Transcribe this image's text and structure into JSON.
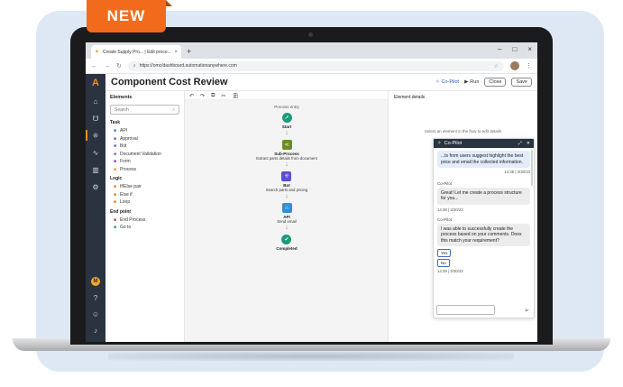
{
  "badge": "NEW",
  "browser": {
    "tab_title": "Create Supply Pro... | Edit proce...",
    "tab_close": "×",
    "new_tab": "+",
    "window_controls": [
      "–",
      "□",
      "×"
    ],
    "url": "https://omc/dashboard.automationanywhere.com"
  },
  "app": {
    "title": "Component Cost Review",
    "copilot_label": "Co-Pilot",
    "run_label": "Run",
    "close_label": "Close",
    "save_label": "Save"
  },
  "elements_panel": {
    "heading": "Elements",
    "search_placeholder": "Search",
    "groups": [
      {
        "title": "Task",
        "items": [
          {
            "label": "API",
            "icon": "api-icon",
            "color": "#3b7dd8"
          },
          {
            "label": "Approval",
            "icon": "approval-icon",
            "color": "#7b4fd8"
          },
          {
            "label": "Bot",
            "icon": "bot-icon",
            "color": "#5b5bd6"
          },
          {
            "label": "Document Validation",
            "icon": "document-icon",
            "color": "#9b59b6"
          },
          {
            "label": "Form",
            "icon": "form-icon",
            "color": "#8e44ad"
          },
          {
            "label": "Process",
            "icon": "process-icon",
            "color": "#f39c12"
          }
        ]
      },
      {
        "title": "Logic",
        "items": [
          {
            "label": "If/Else pair",
            "icon": "if-else-icon",
            "color": "#e67e22"
          },
          {
            "label": "Else if",
            "icon": "else-if-icon",
            "color": "#e67e22"
          },
          {
            "label": "Loop",
            "icon": "loop-icon",
            "color": "#e67e22"
          }
        ]
      },
      {
        "title": "End point",
        "items": [
          {
            "label": "End Process",
            "icon": "end-process-icon",
            "color": "#c0392b"
          },
          {
            "label": "Go to",
            "icon": "goto-icon",
            "color": "#16a085"
          }
        ]
      }
    ]
  },
  "flow": {
    "entry_label": "Process entry",
    "nodes": [
      {
        "label": "Start",
        "sub": "",
        "color": "#1a9a7a",
        "round": true,
        "glyph": "➚"
      },
      {
        "label": "Sub-Process",
        "sub": "Extract parts details from document",
        "color": "#6b8e23",
        "round": false,
        "glyph": "⋖"
      },
      {
        "label": "Bot",
        "sub": "Search parts and pricing",
        "color": "#5b4fd6",
        "round": false,
        "glyph": "⁜"
      },
      {
        "label": "API",
        "sub": "Send email",
        "color": "#2f8fd8",
        "round": false,
        "glyph": "⌂"
      },
      {
        "label": "Completed",
        "sub": "",
        "color": "#1a9a7a",
        "round": true,
        "glyph": "✔"
      }
    ]
  },
  "details_panel": {
    "title": "Element details",
    "hint": "Select an element in the flow to edit details"
  },
  "copilot": {
    "title": "Co-Pilot",
    "messages": [
      {
        "type": "user",
        "text": "...ts from users suggest highlight the best price and email the collected information.",
        "time": "14:38 | 3/30/23"
      },
      {
        "type": "bot",
        "from": "Co-Pilot",
        "text": "Great! Let me create a process structure for you...",
        "time": "14:38 | 3/30/23"
      },
      {
        "type": "bot",
        "from": "Co-Pilot",
        "text": "I was able to successfully create the process based on your comments. Does this match your requirement?",
        "time": "14:39 | 3/30/23"
      }
    ],
    "yes_label": "Yes",
    "no_label": "No"
  }
}
